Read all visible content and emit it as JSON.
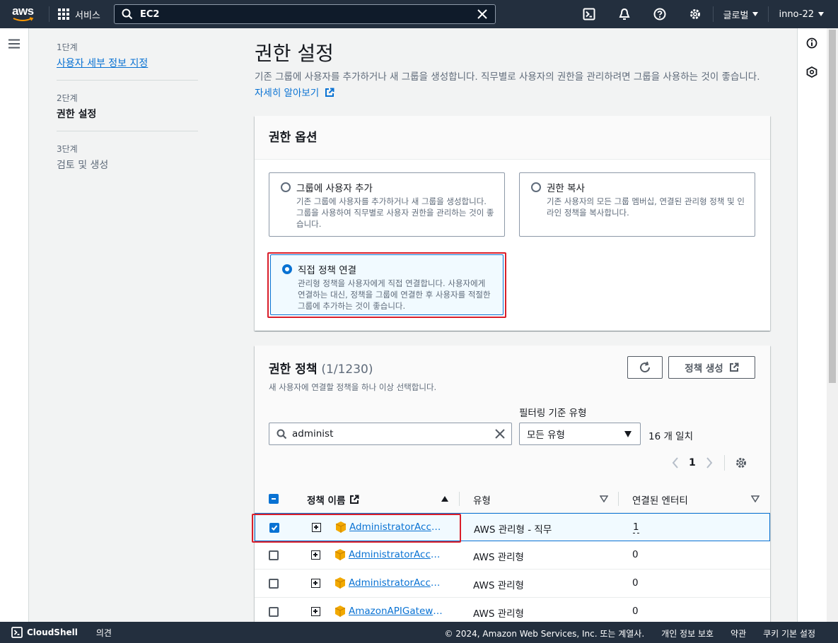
{
  "topnav": {
    "logo": "aws",
    "services": "서비스",
    "search_value": "EC2",
    "region": "글로벌",
    "account": "inno-22"
  },
  "steps": [
    {
      "no": "1단계",
      "label": "사용자 세부 정보 지정"
    },
    {
      "no": "2단계",
      "label": "권한 설정"
    },
    {
      "no": "3단계",
      "label": "검토 및 생성"
    }
  ],
  "page": {
    "title": "권한 설정",
    "description": "기존 그룹에 사용자를 추가하거나 새 그룹을 생성합니다. 직무별로 사용자의 권한을 관리하려면 그룹을 사용하는 것이 좋습니다.",
    "learn_more": "자세히 알아보기"
  },
  "options": {
    "title": "권한 옵션",
    "tiles": [
      {
        "title": "그룹에 사용자 추가",
        "desc": "기존 그룹에 사용자를 추가하거나 새 그룹을 생성합니다. 그룹을 사용하여 직무별로 사용자 권한을 관리하는 것이 좋습니다.",
        "selected": false
      },
      {
        "title": "권한 복사",
        "desc": "기존 사용자의 모든 그룹 멤버십, 연결된 관리형 정책 및 인라인 정책을 복사합니다.",
        "selected": false
      },
      {
        "title": "직접 정책 연결",
        "desc": "관리형 정책을 사용자에게 직접 연결합니다. 사용자에게 연결하는 대신, 정책을 그룹에 연결한 후 사용자를 적절한 그룹에 추가하는 것이 좋습니다.",
        "selected": true
      }
    ]
  },
  "policies": {
    "title": "권한 정책",
    "count": "(1/1230)",
    "desc": "새 사용자에 연결할 정책을 하나 이상 선택합니다.",
    "create_button": "정책 생성",
    "filter_type_label": "필터링 기준 유형",
    "search_value": "administ",
    "type_select": "모든 유형",
    "matches": "16 개 일치",
    "page": "1",
    "columns": [
      "정책 이름",
      "유형",
      "연결된 엔터티"
    ],
    "rows": [
      {
        "name": "AdministratorAccess",
        "type": "AWS 관리형 - 직무",
        "entities": "1",
        "checked": true
      },
      {
        "name": "AdministratorAccess-Amplify",
        "type": "AWS 관리형",
        "entities": "0",
        "checked": false
      },
      {
        "name": "AdministratorAccess-AWSElasticBeanstalk",
        "type": "AWS 관리형",
        "entities": "0",
        "checked": false
      },
      {
        "name": "AmazonAPIGatewayAdministrator",
        "type": "AWS 관리형",
        "entities": "0",
        "checked": false
      }
    ]
  },
  "footer": {
    "cloudshell": "CloudShell",
    "feedback": "의견",
    "copyright": "© 2024, Amazon Web Services, Inc. 또는 계열사.",
    "privacy": "개인 정보 보호",
    "terms": "약관",
    "cookies": "쿠키 기본 설정"
  },
  "colors": {
    "nav": "#232f3e",
    "link": "#0972d3",
    "highlight": "#d91e2a",
    "policy_icon": "#f2a900"
  }
}
